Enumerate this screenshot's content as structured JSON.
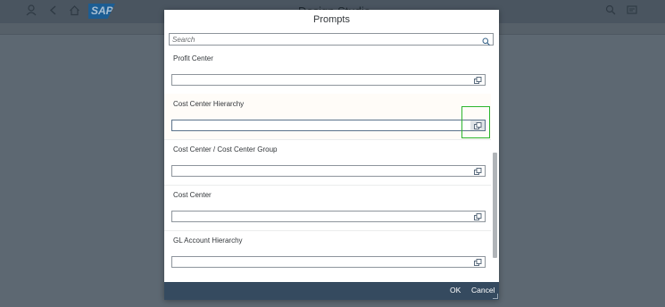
{
  "shell": {
    "title": "Design Studio",
    "logo_text": "SAP",
    "icons": [
      "user-icon",
      "back-icon",
      "home-icon",
      "search-icon",
      "notification-icon"
    ]
  },
  "dialog": {
    "title": "Prompts",
    "search": {
      "placeholder": "Search",
      "value": ""
    },
    "prompts": [
      {
        "label": "Profit Center",
        "value": ""
      },
      {
        "label": "Cost Center Hierarchy",
        "value": ""
      },
      {
        "label": "Cost Center / Cost Center Group",
        "value": ""
      },
      {
        "label": "Cost Center",
        "value": ""
      },
      {
        "label": "GL Account Hierarchy",
        "value": ""
      }
    ],
    "footer": {
      "ok_label": "OK",
      "cancel_label": "Cancel"
    }
  },
  "colors": {
    "footer_bg": "#354a5f",
    "highlight": "#2db52d",
    "sap_blue": "#1c5d93",
    "overlay": "#5d6872"
  }
}
